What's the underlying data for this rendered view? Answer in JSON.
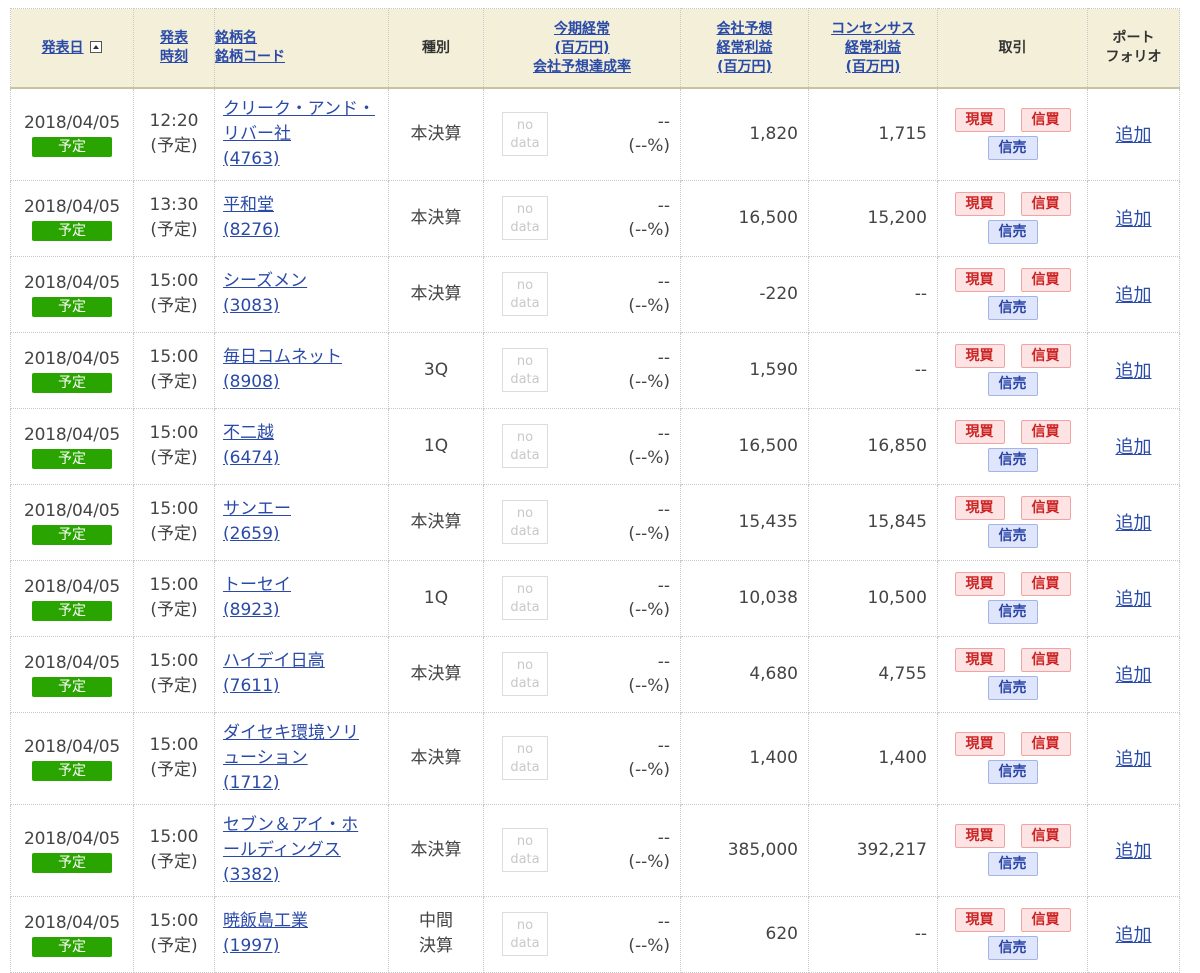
{
  "headers": {
    "date": "発表日",
    "date_icon": "sort-up-icon",
    "time_1": "発表",
    "time_2": "時刻",
    "name_1": "銘柄名",
    "name_2": "銘柄コード",
    "type": "種別",
    "rate_1": "今期経常",
    "rate_2": "(百万円)",
    "rate_3": "会社予想達成率",
    "fcst_1": "会社予想",
    "fcst_2": "経常利益",
    "fcst_3": "(百万円)",
    "cons_1": "コンセンサス",
    "cons_2": "経常利益",
    "cons_3": "(百万円)",
    "trade": "取引",
    "port_1": "ポート",
    "port_2": "フォリオ"
  },
  "labels": {
    "yotei": "予定",
    "nodata_1": "no",
    "nodata_2": "data",
    "dash": "--",
    "pct": "(--%)",
    "buy": "現買",
    "margin_buy": "信買",
    "margin_sell": "信売",
    "add": "追加"
  },
  "rows": [
    {
      "date": "2018/04/05",
      "time": "12:20",
      "time_note": "(予定)",
      "name_lines": [
        "クリーク・アンド・",
        "リバー社"
      ],
      "code": "(4763)",
      "type_lines": [
        "本決算"
      ],
      "forecast": "1,820",
      "consensus": "1,715"
    },
    {
      "date": "2018/04/05",
      "time": "13:30",
      "time_note": "(予定)",
      "name_lines": [
        "平和堂"
      ],
      "code": "(8276)",
      "type_lines": [
        "本決算"
      ],
      "forecast": "16,500",
      "consensus": "15,200"
    },
    {
      "date": "2018/04/05",
      "time": "15:00",
      "time_note": "(予定)",
      "name_lines": [
        "シーズメン"
      ],
      "code": "(3083)",
      "type_lines": [
        "本決算"
      ],
      "forecast": "-220",
      "consensus": "--"
    },
    {
      "date": "2018/04/05",
      "time": "15:00",
      "time_note": "(予定)",
      "name_lines": [
        "毎日コムネット"
      ],
      "code": "(8908)",
      "type_lines": [
        "3Q"
      ],
      "forecast": "1,590",
      "consensus": "--"
    },
    {
      "date": "2018/04/05",
      "time": "15:00",
      "time_note": "(予定)",
      "name_lines": [
        "不二越"
      ],
      "code": "(6474)",
      "type_lines": [
        "1Q"
      ],
      "forecast": "16,500",
      "consensus": "16,850"
    },
    {
      "date": "2018/04/05",
      "time": "15:00",
      "time_note": "(予定)",
      "name_lines": [
        "サンエー"
      ],
      "code": "(2659)",
      "type_lines": [
        "本決算"
      ],
      "forecast": "15,435",
      "consensus": "15,845"
    },
    {
      "date": "2018/04/05",
      "time": "15:00",
      "time_note": "(予定)",
      "name_lines": [
        "トーセイ"
      ],
      "code": "(8923)",
      "type_lines": [
        "1Q"
      ],
      "forecast": "10,038",
      "consensus": "10,500"
    },
    {
      "date": "2018/04/05",
      "time": "15:00",
      "time_note": "(予定)",
      "name_lines": [
        "ハイデイ日高"
      ],
      "code": "(7611)",
      "type_lines": [
        "本決算"
      ],
      "forecast": "4,680",
      "consensus": "4,755"
    },
    {
      "date": "2018/04/05",
      "time": "15:00",
      "time_note": "(予定)",
      "name_lines": [
        "ダイセキ環境ソリ",
        "ューション"
      ],
      "code": "(1712)",
      "type_lines": [
        "本決算"
      ],
      "forecast": "1,400",
      "consensus": "1,400"
    },
    {
      "date": "2018/04/05",
      "time": "15:00",
      "time_note": "(予定)",
      "name_lines": [
        "セブン＆アイ・ホ",
        "ールディングス"
      ],
      "code": "(3382)",
      "type_lines": [
        "本決算"
      ],
      "forecast": "385,000",
      "consensus": "392,217"
    },
    {
      "date": "2018/04/05",
      "time": "15:00",
      "time_note": "(予定)",
      "name_lines": [
        "暁飯島工業"
      ],
      "code": "(1997)",
      "type_lines": [
        "中間",
        "決算"
      ],
      "forecast": "620",
      "consensus": "--"
    }
  ]
}
